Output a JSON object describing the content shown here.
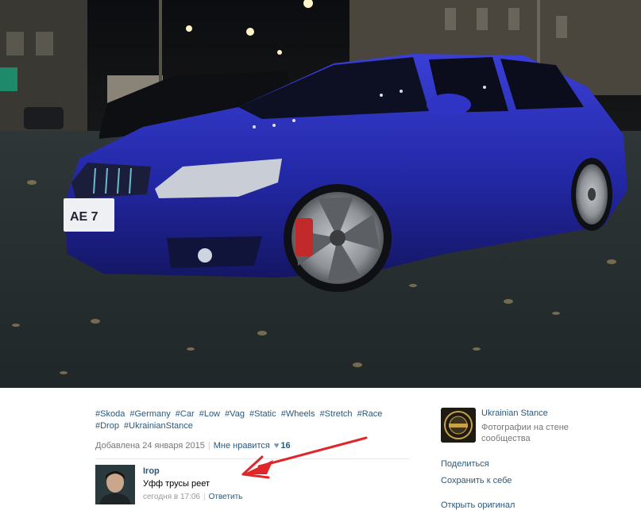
{
  "post": {
    "hashtags": [
      "#Skoda",
      "#Germany",
      "#Car",
      "#Low",
      "#Vag",
      "#Static",
      "#Wheels",
      "#Stretch",
      "#Race",
      "#Drop",
      "#UkrainianStance"
    ],
    "added": "Добавлена 24 января 2015",
    "like_label": "Мне нравится",
    "like_count": "16"
  },
  "comment": {
    "author": "Irop",
    "text": "Уфф трусы реет",
    "time": "сегодня в 17:06",
    "reply": "Ответить"
  },
  "sidebar": {
    "group_name": "Ukrainian Stance",
    "group_subtitle": "Фотографии на стене сообщества",
    "links": [
      "Поделиться",
      "Сохранить к себе",
      "Открыть оригинал"
    ]
  },
  "colors": {
    "link": "#2b587a",
    "meta": "#777777",
    "arrow": "#e0262b",
    "car": "#2a2ec0"
  }
}
